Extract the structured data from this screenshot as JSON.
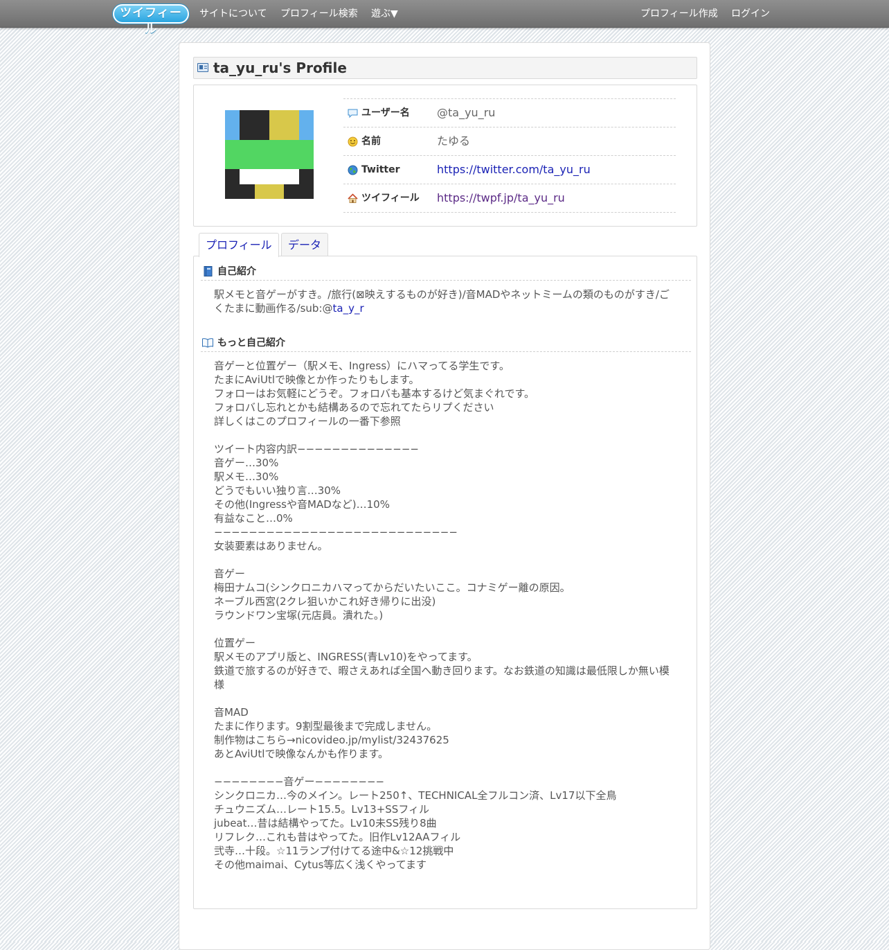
{
  "nav": {
    "logo": "ツイフィール",
    "about": "サイトについて",
    "search": "プロフィール検索",
    "play": "遊ぶ▼",
    "create": "プロフィール作成",
    "login": "ログイン"
  },
  "page_title": "ta_yu_ru's Profile",
  "avatar_colors": {
    "blue": "#63b1ed",
    "dark": "#2a2a2a",
    "yellow": "#d8c84a",
    "green": "#52d662",
    "white": "#ffffff"
  },
  "info": {
    "username_label": "ユーザー名",
    "username_value": "@ta_yu_ru",
    "name_label": "名前",
    "name_value": "たゆる",
    "twitter_label": "Twitter",
    "twitter_value": "https://twitter.com/ta_yu_ru",
    "twpf_label": "ツイフィール",
    "twpf_value": "https://twpf.jp/ta_yu_ru"
  },
  "tabs": {
    "profile": "プロフィール",
    "data": "データ"
  },
  "bio": {
    "title": "自己紹介",
    "text": "駅メモと音ゲーがすき。/旅行(⊠映えするものが好き)/音MADやネットミームの類のものがすき/ごくたまに動画作る/sub:@",
    "link": "ta_y_r"
  },
  "more_bio": {
    "title": "もっと自己紹介",
    "text": "音ゲーと位置ゲー（駅メモ、Ingress）にハマってる学生です。\nたまにAviUtlで映像とか作ったりもします。\nフォローはお気軽にどうぞ。フォロバも基本するけど気まぐれです。\nフォロバし忘れとかも結構あるので忘れてたらリプください\n詳しくはこのプロフィールの一番下参照\n\nツイート内容内訳−−−−−−−−−−−−−−\n音ゲー…30%\n駅メモ…30%\nどうでもいい独り言…30%\nその他(Ingressや音MADなど)…10%\n有益なこと…0%\n−−−−−−−−−−−−−−−−−−−−−−−−−−−−\n女装要素はありません。\n\n音ゲー\n梅田ナムコ(シンクロニカハマってからだいたいここ。コナミゲー離の原因。\nネーブル西宮(2クレ狙いかこれ好き帰りに出没)\nラウンドワン宝塚(元店員。潰れた。)\n\n位置ゲー\n駅メモのアプリ版と、INGRESS(青Lv10)をやってます。\n鉄道で旅するのが好きで、暇さえあれば全国へ動き回ります。なお鉄道の知識は最低限しか無い模様\n\n音MAD\nたまに作ります。9割型最後まで完成しません。\n制作物はこちら→nicovideo.jp/mylist/32437625\nあとAviUtlで映像なんかも作ります。\n\n−−−−−−−−音ゲー−−−−−−−−\nシンクロニカ…今のメイン。レート250↑、TECHNICAL全フルコン済、Lv17以下全鳥\nチュウニズム…レート15.5。Lv13+SSフィル\njubeat…昔は結構やってた。Lv10未SS残り8曲\nリフレク…これも昔はやってた。旧作Lv12AAフィル\n弐寺…十段。☆11ランプ付けてる途中&☆12挑戦中\nその他maimai、Cytus等広く浅くやってます"
  }
}
